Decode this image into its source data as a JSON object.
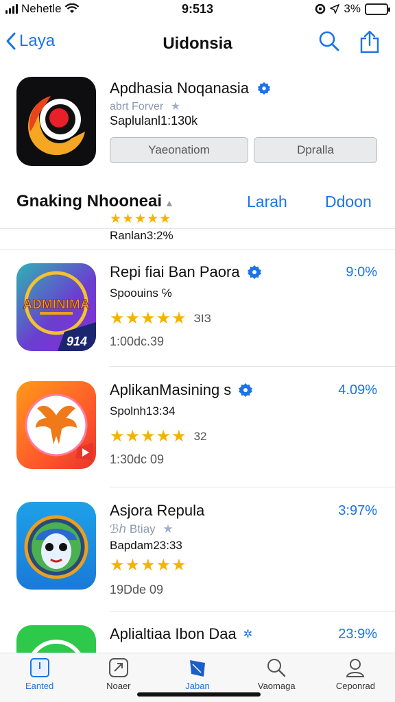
{
  "status": {
    "carrier": "Nehetle",
    "time": "9:513",
    "battery": "3%"
  },
  "nav": {
    "back_label": "Laya",
    "title": "Uidonsia"
  },
  "header_app": {
    "name": "Apdhasia Noqanasia",
    "subtitle": "abrt Forver",
    "size": "Saplulanl1:130k",
    "button1": "Yaeonatiom",
    "button2": "Dpralla",
    "rating_stars": "★★★★★",
    "rank": "Ranlan3:2%"
  },
  "section": {
    "title": "Gnaking Nhooneai",
    "link1": "Larah",
    "link2": "Ddoon"
  },
  "apps": [
    {
      "name": "Repi fiai Ban Paora",
      "pct": "9:0%",
      "line2": "Spoouins ℅",
      "stars": "★★★★★",
      "rating_count": "ЗІЗ",
      "line4": "1:00dc.39",
      "icon_text": "ADMINIMA",
      "icon_badge": "914"
    },
    {
      "name": "AplikanMasining s",
      "pct": "4.09%",
      "line2": "Spolnh13:34",
      "stars": "★★★★★",
      "rating_count": "32",
      "line4": "1:30dc 09"
    },
    {
      "name": "Asjora Repula",
      "pct": "3:97%",
      "line2": "ℬℎ Btiay",
      "line3": "Bapdam23:33",
      "stars": "★★★★★",
      "rating_count": "",
      "line4": "19Dde 09"
    },
    {
      "name": "Aplialtiaa Ibon Daa",
      "pct": "23:9%"
    }
  ],
  "tabs": [
    {
      "label": "Eanted",
      "icon": "today-icon"
    },
    {
      "label": "Noaer",
      "icon": "games-icon"
    },
    {
      "label": "Jaban",
      "icon": "apps-icon"
    },
    {
      "label": "Vaomaga",
      "icon": "search-icon"
    },
    {
      "label": "Ceponrad",
      "icon": "account-icon"
    }
  ],
  "colors": {
    "accent": "#1a73e8",
    "star": "#f5b300",
    "battery": "#33c24d"
  }
}
